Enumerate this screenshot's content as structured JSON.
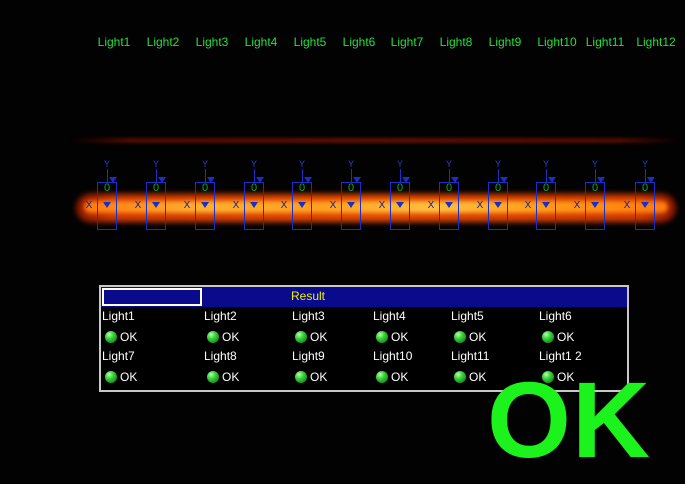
{
  "lights": [
    {
      "name": "Light1",
      "value": "0",
      "status": "OK"
    },
    {
      "name": "Light2",
      "value": "0",
      "status": "OK"
    },
    {
      "name": "Light3",
      "value": "0",
      "status": "OK"
    },
    {
      "name": "Light4",
      "value": "0",
      "status": "OK"
    },
    {
      "name": "Light5",
      "value": "0",
      "status": "OK"
    },
    {
      "name": "Light6",
      "value": "0",
      "status": "OK"
    },
    {
      "name": "Light7",
      "value": "0",
      "status": "OK"
    },
    {
      "name": "Light8",
      "value": "0",
      "status": "OK"
    },
    {
      "name": "Light9",
      "value": "0",
      "status": "OK"
    },
    {
      "name": "Light10",
      "value": "0",
      "status": "OK"
    },
    {
      "name": "Light11",
      "value": "0",
      "status": "OK"
    },
    {
      "name": "Light12",
      "value": "0",
      "status": "OK"
    }
  ],
  "overlay_markers": {
    "y_label": "Y",
    "x_label": "X"
  },
  "result_panel": {
    "title": "Result",
    "field_value": "",
    "labels": [
      "Light1",
      "Light2",
      "Light3",
      "Light4",
      "Light5",
      "Light6",
      "Light7",
      "Light8",
      "Light9",
      "Light10",
      "Light11",
      "Light1 2"
    ]
  },
  "overall_status": "OK",
  "colors": {
    "label_green": "#22e03a",
    "status_green": "#1cf21c",
    "panel_blue": "#0a0a8c",
    "roi_blue": "#1a2ec8"
  },
  "icons": {
    "status_led": "green-led-icon"
  }
}
